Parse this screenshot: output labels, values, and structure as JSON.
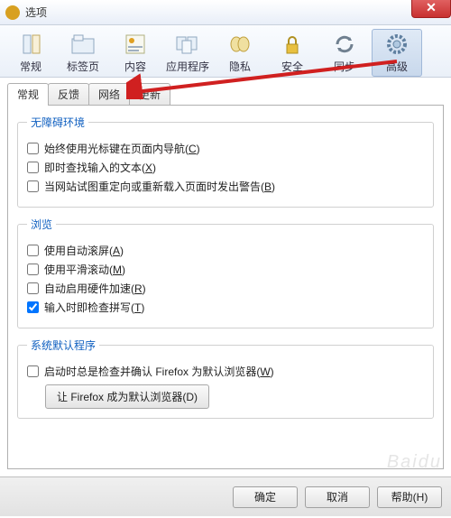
{
  "window": {
    "title": "选项"
  },
  "toolbar": [
    {
      "key": "general",
      "label": "常规"
    },
    {
      "key": "tabs",
      "label": "标签页"
    },
    {
      "key": "content",
      "label": "内容"
    },
    {
      "key": "apps",
      "label": "应用程序"
    },
    {
      "key": "privacy",
      "label": "隐私"
    },
    {
      "key": "security",
      "label": "安全"
    },
    {
      "key": "sync",
      "label": "同步"
    },
    {
      "key": "advanced",
      "label": "高级",
      "active": true
    }
  ],
  "subtabs": [
    {
      "key": "general",
      "label": "常规",
      "active": true
    },
    {
      "key": "feedback",
      "label": "反馈"
    },
    {
      "key": "network",
      "label": "网络"
    },
    {
      "key": "update",
      "label": "更新"
    }
  ],
  "sections": {
    "accessibility": {
      "legend": "无障碍环境",
      "items": [
        {
          "label": "始终使用光标键在页面内导航(",
          "mnemonic": "C",
          "suffix": ")",
          "checked": false
        },
        {
          "label": "即时查找输入的文本(",
          "mnemonic": "X",
          "suffix": ")",
          "checked": false
        },
        {
          "label": "当网站试图重定向或重新载入页面时发出警告(",
          "mnemonic": "B",
          "suffix": ")",
          "checked": false
        }
      ]
    },
    "browsing": {
      "legend": "浏览",
      "items": [
        {
          "label": "使用自动滚屏(",
          "mnemonic": "A",
          "suffix": ")",
          "checked": false
        },
        {
          "label": "使用平滑滚动(",
          "mnemonic": "M",
          "suffix": ")",
          "checked": false
        },
        {
          "label": "自动启用硬件加速(",
          "mnemonic": "R",
          "suffix": ")",
          "checked": false
        },
        {
          "label": "输入时即检查拼写(",
          "mnemonic": "T",
          "suffix": ")",
          "checked": true
        }
      ]
    },
    "system_default": {
      "legend": "系统默认程序",
      "items": [
        {
          "label": "启动时总是检查并确认 Firefox 为默认浏览器(",
          "mnemonic": "W",
          "suffix": ")",
          "checked": false
        }
      ],
      "button": "让 Firefox 成为默认浏览器(D)"
    }
  },
  "buttons": {
    "ok": "确定",
    "cancel": "取消",
    "help": "帮助(H)"
  }
}
